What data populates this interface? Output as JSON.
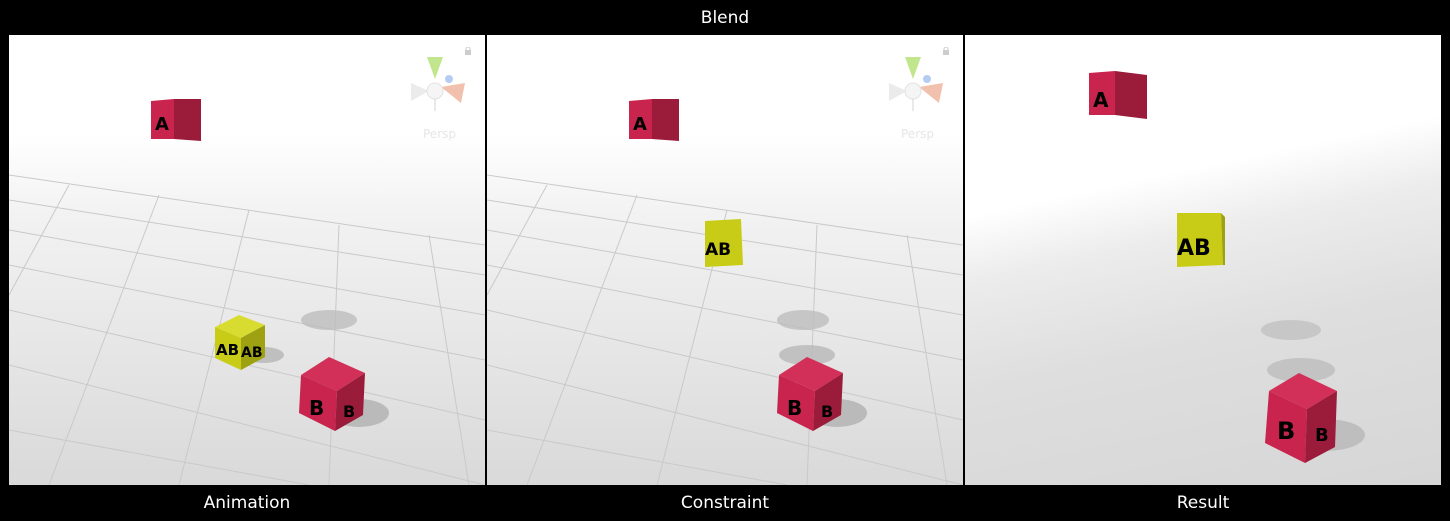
{
  "header": {
    "title": "Blend"
  },
  "panels": {
    "animation": {
      "caption": "Animation",
      "gizmo_label": "Persp",
      "cube_a": "A",
      "cube_ab": "AB",
      "cube_b": "B"
    },
    "constraint": {
      "caption": "Constraint",
      "gizmo_label": "Persp",
      "cube_a": "A",
      "cube_ab": "AB",
      "cube_b": "B"
    },
    "result": {
      "caption": "Result",
      "cube_a": "A",
      "cube_ab": "AB",
      "cube_b": "B"
    }
  },
  "colors": {
    "cube_red": "#c8244e",
    "cube_red_dark": "#9b1b3a",
    "cube_yellow": "#c8cc17",
    "cube_yellow_dark": "#9ea111"
  },
  "icons": [
    "scene-gizmo-icon",
    "lock-icon"
  ]
}
